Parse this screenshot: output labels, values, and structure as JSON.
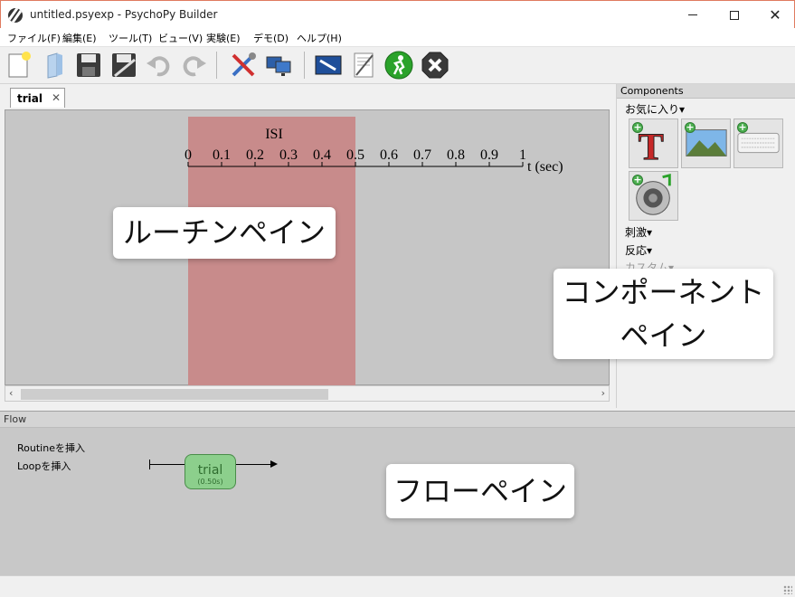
{
  "window": {
    "title": "untitled.psyexp - PsychoPy Builder",
    "controls": {
      "minimize": "",
      "maximize": "",
      "close": "✕"
    }
  },
  "menu": [
    {
      "label": "ファイル(F)"
    },
    {
      "label": "編集(E)"
    },
    {
      "label": "ツール(T)"
    },
    {
      "label": "ビュー(V)"
    },
    {
      "label": "実験(E)"
    },
    {
      "label": "デモ(D)"
    },
    {
      "label": "ヘルプ(H)"
    }
  ],
  "toolbar": {
    "icons": [
      "new-file-icon",
      "open-folder-icon",
      "save-icon",
      "save-as-icon",
      "undo-icon",
      "redo-icon",
      "preferences-icon",
      "monitor-center-icon",
      "experiment-settings-icon",
      "compile-script-icon",
      "run-icon",
      "stop-icon"
    ]
  },
  "routine": {
    "tab_label": "trial",
    "tab_close": "✕",
    "component_name": "ISI",
    "axis_ticks": [
      "0",
      "0.1",
      "0.2",
      "0.3",
      "0.4",
      "0.5",
      "0.6",
      "0.7",
      "0.8",
      "0.9",
      "1"
    ],
    "axis_unit": "t (sec)",
    "isi_start": 0,
    "isi_end": 0.5,
    "axis_max": 1
  },
  "components": {
    "header": "Components",
    "favorites_label": "お気に入り▾",
    "favorite_icons": [
      "text-component-icon",
      "image-component-icon",
      "keyboard-component-icon",
      "sound-component-icon"
    ],
    "categories": [
      {
        "label": "刺激▾"
      },
      {
        "label": "反応▾"
      },
      {
        "label": "カスタム▾"
      }
    ]
  },
  "flow": {
    "header": "Flow",
    "insert_routine": "Routineを挿入",
    "insert_loop": "Loopを挿入",
    "routine_name": "trial",
    "routine_duration": "(0.50s)"
  },
  "annotations": {
    "routine_pane": "ルーチンペイン",
    "component_pane_line1": "コンポーネント",
    "component_pane_line2": "ペイン",
    "flow_pane": "フローペイン"
  },
  "colors": {
    "isi_bar": "#c88b8b",
    "routine_canvas": "#c6c6c6",
    "flow_routine_fill": "#8ccf8c"
  }
}
